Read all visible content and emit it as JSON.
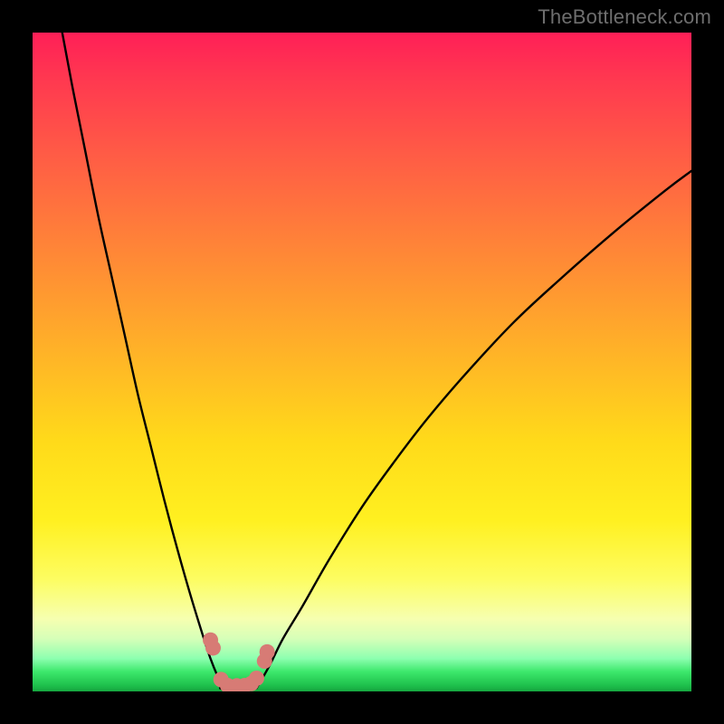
{
  "watermark": {
    "text": "TheBottleneck.com"
  },
  "colors": {
    "frame": "#000000",
    "curve": "#000000",
    "marker_fill": "#d77b75",
    "marker_stroke": "#d77b75"
  },
  "chart_data": {
    "type": "line",
    "title": "",
    "xlabel": "",
    "ylabel": "",
    "xlim": [
      0,
      100
    ],
    "ylim": [
      0,
      100
    ],
    "grid": false,
    "legend": false,
    "note": "Axes are unlabeled in the source image; x/y extents are normalized to 0–100. Series values are vertical positions estimated from the image (0 = bottom, 100 = top).",
    "series": [
      {
        "name": "left-curve",
        "x": [
          4.5,
          6,
          8,
          10,
          12,
          14,
          16,
          18,
          20,
          22,
          24,
          26,
          27,
          28,
          29
        ],
        "values": [
          100,
          92,
          82,
          72,
          63,
          54,
          45,
          37,
          29,
          21.5,
          14.5,
          8,
          5,
          2.5,
          0.5
        ]
      },
      {
        "name": "right-curve",
        "x": [
          34,
          36,
          38,
          41,
          45,
          50,
          55,
          60,
          66,
          73,
          80,
          88,
          96,
          100
        ],
        "values": [
          0.5,
          4,
          8,
          13,
          20,
          28,
          35,
          41.5,
          48.5,
          56,
          62.5,
          69.5,
          76,
          79
        ]
      },
      {
        "name": "valley-floor",
        "x": [
          28.5,
          29.5,
          30.5,
          31.5,
          32.5,
          33.5
        ],
        "values": [
          0.5,
          0.2,
          0.2,
          0.2,
          0.3,
          0.5
        ]
      }
    ],
    "markers": [
      {
        "x": 27.0,
        "y": 7.8
      },
      {
        "x": 27.4,
        "y": 6.6
      },
      {
        "x": 28.6,
        "y": 1.8
      },
      {
        "x": 29.6,
        "y": 0.9
      },
      {
        "x": 31.0,
        "y": 0.85
      },
      {
        "x": 32.2,
        "y": 0.9
      },
      {
        "x": 33.2,
        "y": 1.2
      },
      {
        "x": 34.0,
        "y": 2.0
      },
      {
        "x": 35.2,
        "y": 4.6
      },
      {
        "x": 35.6,
        "y": 6.0
      }
    ]
  }
}
